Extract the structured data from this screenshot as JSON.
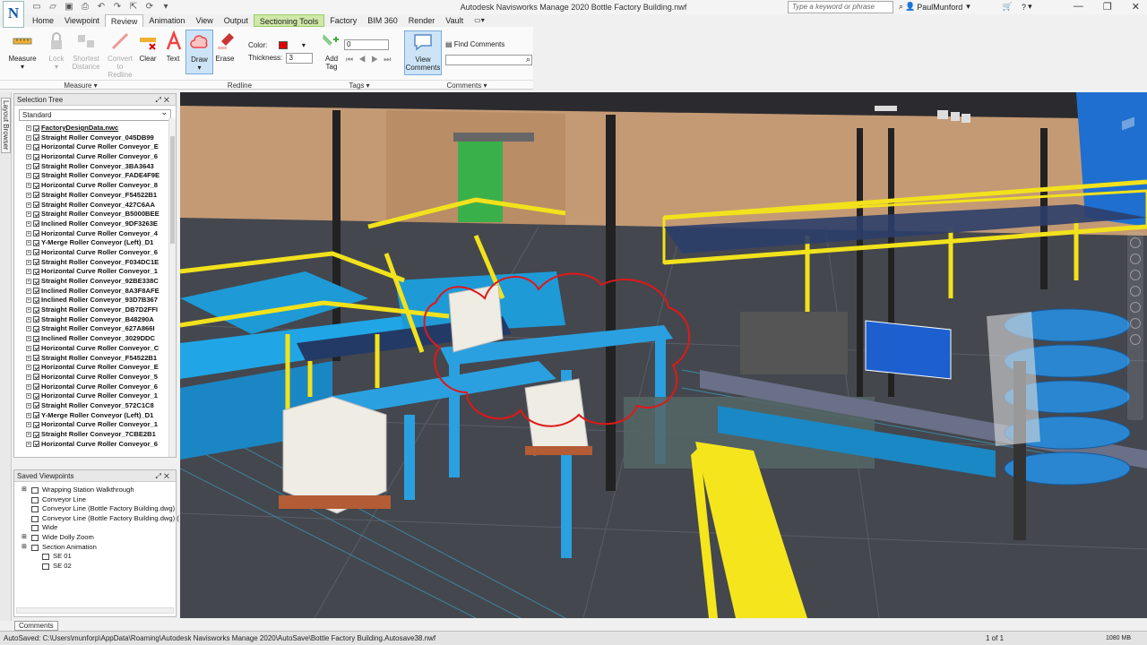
{
  "window": {
    "title": "Autodesk Navisworks Manage 2020   Bottle Factory Building.nwf",
    "search_placeholder": "Type a keyword or phrase",
    "user": "PaulMunford"
  },
  "ribbon": {
    "tabs": [
      "Home",
      "Viewpoint",
      "Review",
      "Animation",
      "View",
      "Output",
      "Sectioning Tools",
      "Factory",
      "BIM 360",
      "Render",
      "Vault"
    ],
    "active_tab": "Review",
    "contextual_tab": "Sectioning Tools",
    "measure_label": "Measure",
    "lock_label": "Lock",
    "shortest_label": "Shortest Distance",
    "convert_label": "Convert to Redline",
    "clear_label": "Clear",
    "text_label": "Text",
    "draw_label": "Draw",
    "erase_label": "Erase",
    "color_label": "Color:",
    "color_value": "#e00000",
    "thickness_label": "Thickness:",
    "thickness_value": "3",
    "add_tag_label": "Add Tag",
    "tag_value": "0",
    "view_comments_label": "View Comments",
    "find_comments_label": "Find Comments",
    "groups": {
      "measure": "Measure",
      "redline": "Redline",
      "tags": "Tags",
      "comments": "Comments"
    }
  },
  "left_strip": {
    "label": "Layout Browser"
  },
  "selection_tree": {
    "title": "Selection Tree",
    "mode": "Standard",
    "root": "FactoryDesignData.nwc",
    "items": [
      "Straight Roller Conveyor_045DB99",
      "Horizontal Curve Roller Conveyor_E",
      "Horizontal Curve Roller Conveyor_6",
      "Straight Roller Conveyor_3BA3643",
      "Straight Roller Conveyor_FADE4F9E",
      "Horizontal Curve Roller Conveyor_8",
      "Straight Roller Conveyor_F54522B1",
      "Straight Roller Conveyor_427C6AA",
      "Straight Roller Conveyor_B5000BEE",
      "Inclined Roller Conveyor_9DF3263E",
      "Horizontal Curve Roller Conveyor_4",
      "Y-Merge Roller Conveyor (Left)_D1",
      "Horizontal Curve Roller Conveyor_6",
      "Straight Roller Conveyor_F034DC1E",
      "Horizontal Curve Roller Conveyor_1",
      "Straight Roller Conveyor_92BE338C",
      "Inclined Roller Conveyor_8A3F8AFE",
      "Inclined Roller Conveyor_93D7B367",
      "Straight Roller Conveyor_DB7D2FFI",
      "Straight Roller Conveyor_B48290A",
      "Straight Roller Conveyor_627A866I",
      "Inclined Roller Conveyor_3029DDC",
      "Horizontal Curve Roller Conveyor_C",
      "Straight Roller Conveyor_F54522B1",
      "Horizontal Curve Roller Conveyor_E",
      "Horizontal Curve Roller Conveyor_5",
      "Horizontal Curve Roller Conveyor_6",
      "Horizontal Curve Roller Conveyor_1",
      "Straight Roller Conveyor_572C1C8",
      "Y-Merge Roller Conveyor (Left)_D1",
      "Horizontal Curve Roller Conveyor_1",
      "Straight Roller Conveyor_7CBE2B1",
      "Horizontal Curve Roller Conveyor_6"
    ]
  },
  "saved_viewpoints": {
    "title": "Saved Viewpoints",
    "items": [
      {
        "label": "Wrapping Station Walkthrough",
        "level": 0,
        "expand": true
      },
      {
        "label": "Conveyor Line",
        "level": 0,
        "expand": false
      },
      {
        "label": "Conveyor Line (Bottle Factory Building.dwg)",
        "level": 0,
        "expand": false
      },
      {
        "label": "Conveyor Line (Bottle Factory Building.dwg) (",
        "level": 0,
        "expand": false
      },
      {
        "label": "Wide",
        "level": 0,
        "expand": false
      },
      {
        "label": "Wide Dolly Zoom",
        "level": 0,
        "expand": true
      },
      {
        "label": "Section Animation",
        "level": 0,
        "expand": true
      },
      {
        "label": "SE 01",
        "level": 1,
        "expand": false
      },
      {
        "label": "SE 02",
        "level": 1,
        "expand": false
      }
    ]
  },
  "bottom_tab": "Comments",
  "status": {
    "autosave": "AutoSaved: C:\\Users\\munforp\\AppData\\Roaming\\Autodesk Navisworks Manage 2020\\AutoSave\\Bottle Factory Building.Autosave38.nwf",
    "page": "1 of 1",
    "memory": "1080 MB"
  }
}
